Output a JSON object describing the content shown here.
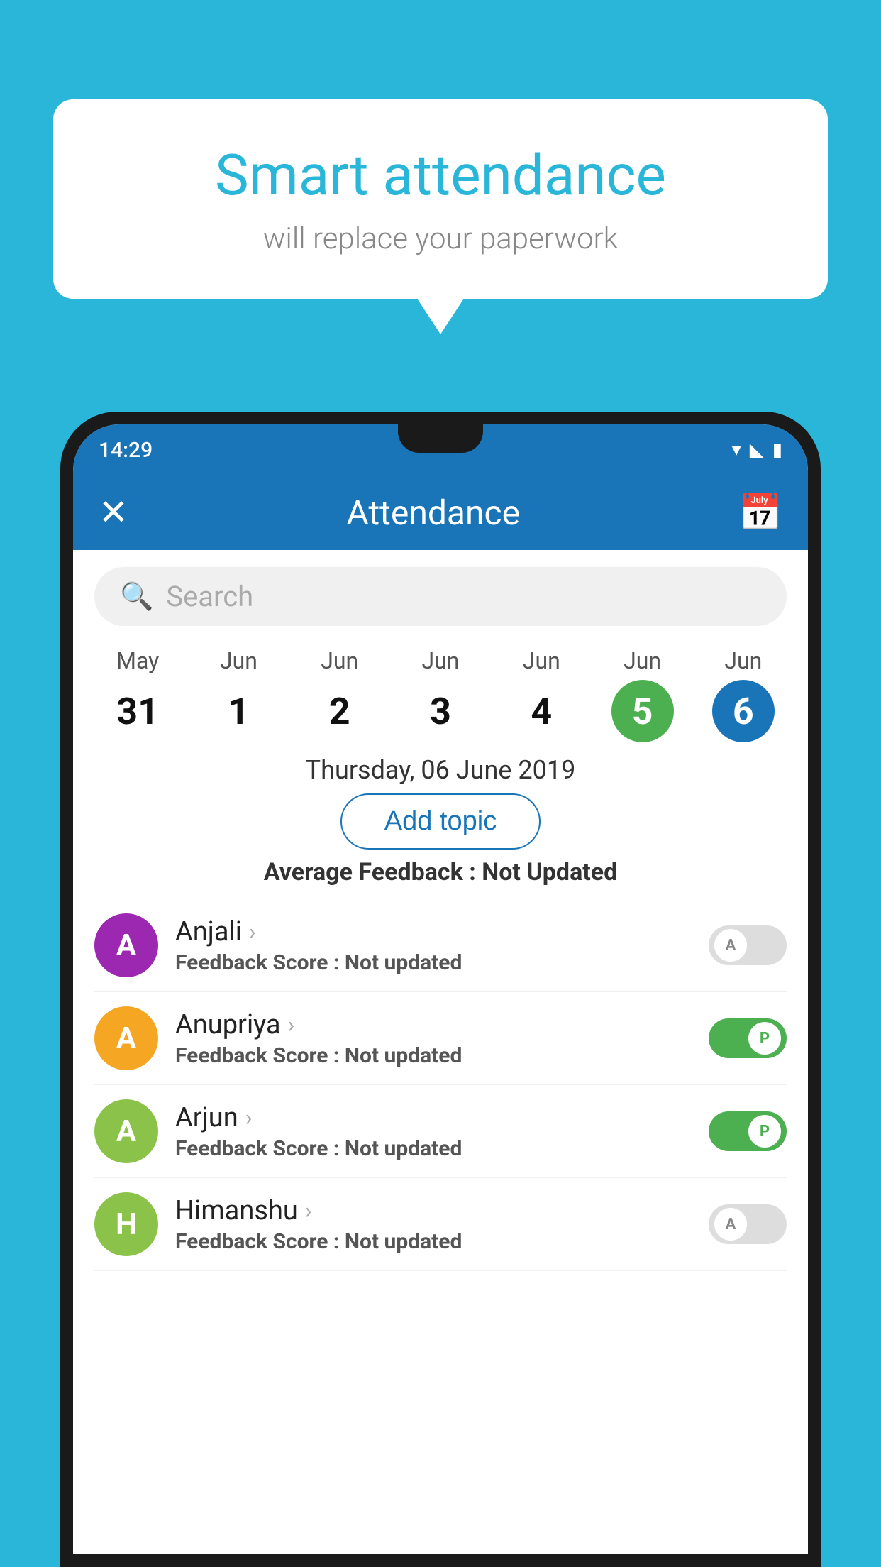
{
  "background_color": "#29b6d8",
  "speech_bubble": {
    "title": "Smart attendance",
    "subtitle": "will replace your paperwork"
  },
  "status_bar": {
    "time": "14:29",
    "wifi_icon": "▾",
    "signal_icon": "▲",
    "battery_icon": "▮"
  },
  "toolbar": {
    "title": "Attendance",
    "close_icon": "✕",
    "calendar_icon": "📅"
  },
  "search": {
    "placeholder": "Search"
  },
  "dates": [
    {
      "month": "May",
      "day": "31",
      "active": false,
      "color": ""
    },
    {
      "month": "Jun",
      "day": "1",
      "active": false,
      "color": ""
    },
    {
      "month": "Jun",
      "day": "2",
      "active": false,
      "color": ""
    },
    {
      "month": "Jun",
      "day": "3",
      "active": false,
      "color": ""
    },
    {
      "month": "Jun",
      "day": "4",
      "active": false,
      "color": ""
    },
    {
      "month": "Jun",
      "day": "5",
      "active": true,
      "color": "green"
    },
    {
      "month": "Jun",
      "day": "6",
      "active": true,
      "color": "blue"
    }
  ],
  "selected_date": "Thursday, 06 June 2019",
  "add_topic_label": "Add topic",
  "avg_feedback_label": "Average Feedback :",
  "avg_feedback_value": "Not Updated",
  "students": [
    {
      "name": "Anjali",
      "avatar_letter": "A",
      "avatar_color": "#9c27b0",
      "feedback_label": "Feedback Score :",
      "feedback_value": "Not updated",
      "toggle": "off",
      "toggle_letter": "A"
    },
    {
      "name": "Anupriya",
      "avatar_letter": "A",
      "avatar_color": "#f5a623",
      "feedback_label": "Feedback Score :",
      "feedback_value": "Not updated",
      "toggle": "on",
      "toggle_letter": "P"
    },
    {
      "name": "Arjun",
      "avatar_letter": "A",
      "avatar_color": "#8bc34a",
      "feedback_label": "Feedback Score :",
      "feedback_value": "Not updated",
      "toggle": "on",
      "toggle_letter": "P"
    },
    {
      "name": "Himanshu",
      "avatar_letter": "H",
      "avatar_color": "#8bc34a",
      "feedback_label": "Feedback Score :",
      "feedback_value": "Not updated",
      "toggle": "off",
      "toggle_letter": "A"
    }
  ]
}
